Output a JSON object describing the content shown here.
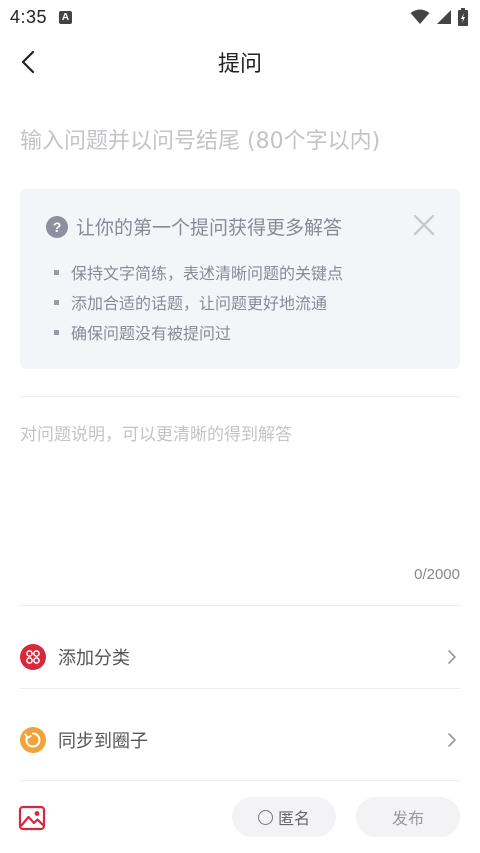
{
  "status_bar": {
    "time": "4:35",
    "notification_icon_text": "A"
  },
  "header": {
    "title": "提问"
  },
  "question": {
    "placeholder": "输入问题并以问号结尾 (80个字以内)",
    "value": ""
  },
  "tips": {
    "title": "让你的第一个提问获得更多解答",
    "items": [
      "保持文字简练，表述清晰问题的关键点",
      "添加合适的话题，让问题更好地流通",
      "确保问题没有被提问过"
    ]
  },
  "description": {
    "placeholder": "对问题说明，可以更清晰的得到解答",
    "value": "",
    "char_count": "0/2000"
  },
  "options": [
    {
      "label": "添加分类",
      "icon": "category-icon",
      "icon_color": "#d8283a"
    },
    {
      "label": "同步到圈子",
      "icon": "sync-circle-icon",
      "icon_color": "#f2a23a"
    }
  ],
  "bottom_bar": {
    "anonymous_label": "匿名",
    "publish_label": "发布",
    "image_icon_color": "#d8283a"
  }
}
